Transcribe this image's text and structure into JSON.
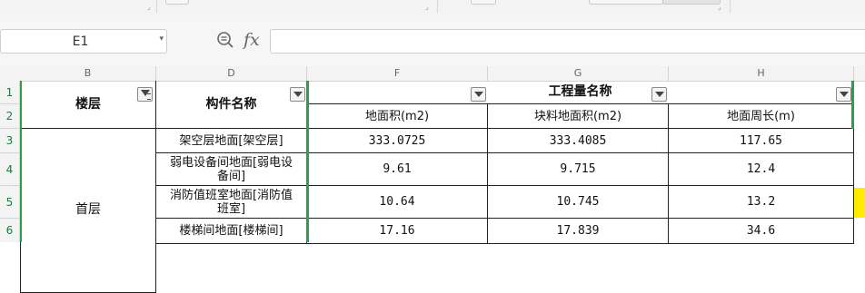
{
  "formula_bar": {
    "cell_ref": "E1",
    "fx_label": "fx",
    "formula": ""
  },
  "columns": [
    "B",
    "D",
    "F",
    "G",
    "H"
  ],
  "rows": [
    "1",
    "2",
    "3",
    "4",
    "5",
    "6"
  ],
  "table": {
    "floor_header": "楼层",
    "component_header": "构件名称",
    "quantity_header": "工程量名称",
    "sub_headers": [
      "地面积(m2)",
      "块料地面积(m2)",
      "地面周长(m)"
    ],
    "floor_value": "首层",
    "rows": [
      {
        "name": "架空层地面[架空层]",
        "area": "333.0725",
        "block_area": "333.4085",
        "perimeter": "117.65"
      },
      {
        "name": "弱电设备间地面[弱电设备间]",
        "area": "9.61",
        "block_area": "9.715",
        "perimeter": "12.4"
      },
      {
        "name": "消防值班室地面[消防值班室]",
        "area": "10.64",
        "block_area": "10.745",
        "perimeter": "13.2"
      },
      {
        "name": "楼梯间地面[楼梯间]",
        "area": "17.16",
        "block_area": "17.839",
        "perimeter": "34.6"
      }
    ]
  },
  "colors": {
    "accent_green": "#2e9d4c",
    "highlight_yellow": "#ffec00"
  }
}
